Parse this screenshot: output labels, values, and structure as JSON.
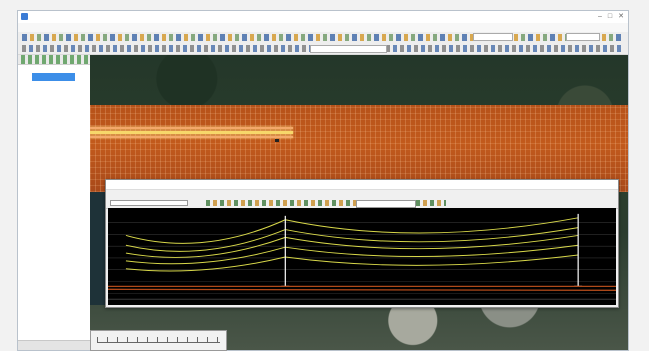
{
  "window": {
    "title": "",
    "controls": {
      "minimize": "–",
      "maximize": "□",
      "close": "✕"
    }
  },
  "menubar": {
    "items": []
  },
  "profile_view": {
    "title": "",
    "menu": [],
    "left_label": "",
    "right_label": ""
  },
  "colors": {
    "lidar_orange": "#c25a1c",
    "conductor_yellow": "#d8d84a",
    "selection_blue": "#3c8ee8",
    "plot_background": "#000000"
  },
  "icons": [
    "app-icon",
    "toolbar-icons",
    "layer-tools-icons",
    "profile-toolbar-icons"
  ]
}
